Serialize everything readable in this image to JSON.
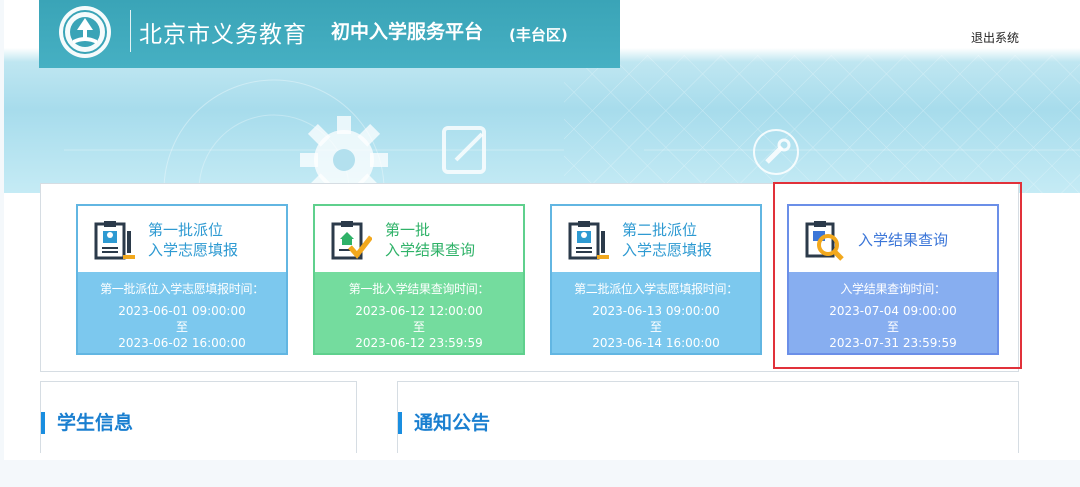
{
  "header": {
    "title_main": "北京市义务教育",
    "title_sub": "初中入学服务平台",
    "title_region": "(丰台区)",
    "logout_label": "退出系统"
  },
  "cards": [
    {
      "name_line1": "第一批派位",
      "name_line2": "入学志愿填报",
      "time_label": "第一批派位入学志愿填报时间：",
      "start": "2023-06-01 09:00:00",
      "to": "至",
      "end": "2023-06-02 16:00:00",
      "icon": "form-fill-icon"
    },
    {
      "name_line1": "第一批",
      "name_line2": "入学结果查询",
      "time_label": "第一批入学结果查询时间：",
      "start": "2023-06-12 12:00:00",
      "to": "至",
      "end": "2023-06-12 23:59:59",
      "icon": "result-check-icon"
    },
    {
      "name_line1": "第二批派位",
      "name_line2": "入学志愿填报",
      "time_label": "第二批派位入学志愿填报时间：",
      "start": "2023-06-13 09:00:00",
      "to": "至",
      "end": "2023-06-14 16:00:00",
      "icon": "form-fill-icon"
    },
    {
      "name_line1": "入学结果查询",
      "time_label": "入学结果查询时间：",
      "start": "2023-07-04 09:00:00",
      "to": "至",
      "end": "2023-07-31 23:59:59",
      "icon": "result-search-icon"
    }
  ],
  "sections": {
    "student_info_title": "学生信息",
    "notice_title": "通知公告"
  },
  "colors": {
    "header_bg": "#3aa4b7",
    "blue_card": "#7cc8ee",
    "green_card": "#74dc9e",
    "purple_card": "#87aef0",
    "highlight": "#e1313a",
    "section_title": "#1a7fd0"
  }
}
